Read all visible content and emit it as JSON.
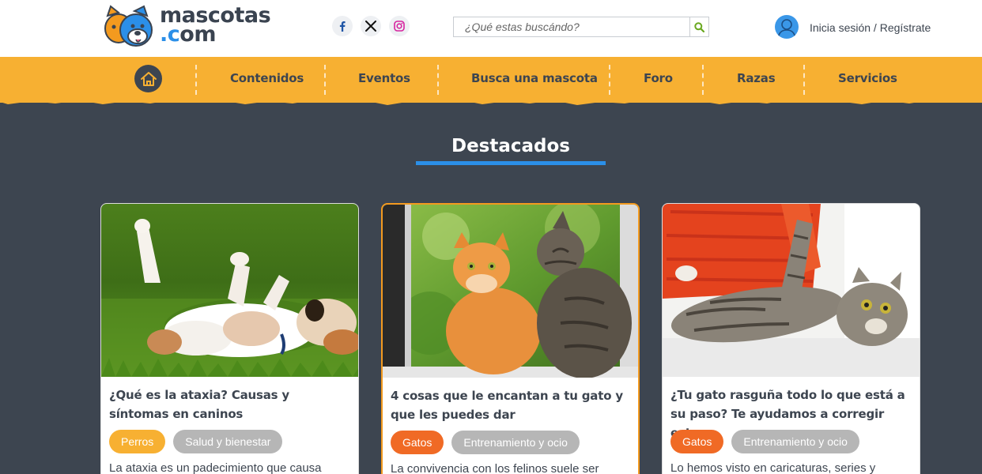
{
  "header": {
    "logo_line1": "mascotas",
    "logo_line2": ".com",
    "social": [
      "facebook-icon",
      "x-icon",
      "instagram-icon"
    ],
    "search_placeholder": "¿Qué estas buscándo?",
    "login_label": "Inicia sesión",
    "separator": " / ",
    "register_label": "Regístrate"
  },
  "nav": {
    "items": [
      "Contenidos",
      "Eventos",
      "Busca una mascota",
      "Foro",
      "Razas",
      "Servicios"
    ]
  },
  "section": {
    "title": "Destacados"
  },
  "cards": [
    {
      "title": "¿Qué es la ataxia? Causas y síntomas en caninos",
      "tags": [
        "Perros",
        "Salud y bienestar"
      ],
      "excerpt": "La ataxia es un padecimiento que causa"
    },
    {
      "title": "4 cosas que le encantan a tu gato y que les puedes dar",
      "tags": [
        "Gatos",
        "Entrenamiento y ocio"
      ],
      "excerpt": "La convivencia con los felinos suele ser"
    },
    {
      "title": "¿Tu gato rasguña todo lo que está a su paso? Te ayudamos a corregir esta...",
      "tags": [
        "Gatos",
        "Entrenamiento y ocio"
      ],
      "excerpt": "Lo hemos visto en caricaturas, series y"
    }
  ],
  "colors": {
    "nav": "#f7b032",
    "background": "#3d4550",
    "accent_blue": "#2b8fe8",
    "tag_dogs": "#f7b032",
    "tag_cats": "#f06a25",
    "tag_topic": "#b6b6b6"
  }
}
